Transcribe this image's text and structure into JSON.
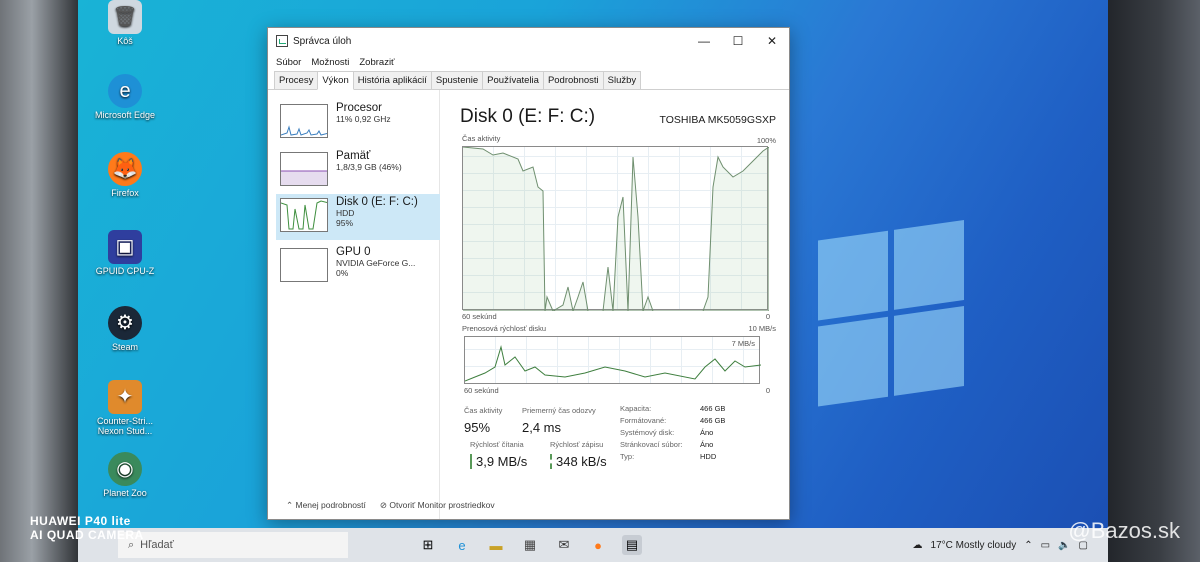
{
  "desktop": {
    "icons": [
      {
        "label": "Kôš",
        "icon": "recycle-bin-icon"
      },
      {
        "label": "Microsoft Edge",
        "icon": "edge-icon"
      },
      {
        "label": "Firefox",
        "icon": "firefox-icon"
      },
      {
        "label": "GPUID CPU-Z",
        "icon": "cpuz-icon"
      },
      {
        "label": "Steam",
        "icon": "steam-icon"
      },
      {
        "label": "Counter-Stri... Nexon Stud...",
        "icon": "counter-strike-icon"
      },
      {
        "label": "Planet Zoo",
        "icon": "planet-zoo-icon"
      }
    ]
  },
  "window": {
    "title": "Správca úloh",
    "menu": [
      "Súbor",
      "Možnosti",
      "Zobraziť"
    ],
    "tabs": [
      "Procesy",
      "Výkon",
      "História aplikácií",
      "Spustenie",
      "Používatelia",
      "Podrobnosti",
      "Služby"
    ],
    "active_tab": "Výkon",
    "resources": [
      {
        "name": "Procesor",
        "line1": "11% 0,92 GHz",
        "line2": ""
      },
      {
        "name": "Pamäť",
        "line1": "1,8/3,9 GB (46%)",
        "line2": ""
      },
      {
        "name": "Disk 0 (E: F: C:)",
        "line1": "HDD",
        "line2": "95%"
      },
      {
        "name": "GPU 0",
        "line1": "NVIDIA GeForce G...",
        "line2": "0%"
      }
    ],
    "detail": {
      "title": "Disk 0 (E: F: C:)",
      "model": "TOSHIBA MK5059GSXP",
      "graph1_label": "Čas aktivity",
      "graph1_max": "100%",
      "graph1_time": "60 sekúnd",
      "graph1_min": "0",
      "graph2_label": "Prenosová rýchlosť disku",
      "graph2_max": "10 MB/s",
      "graph2_mid": "7 MB/s",
      "graph2_time": "60 sekúnd",
      "graph2_min": "0",
      "stats": {
        "active_time_label": "Čas aktivity",
        "active_time": "95%",
        "resp_label": "Priemerný čas odozvy",
        "resp": "2,4 ms",
        "read_label": "Rýchlosť čítania",
        "read": "3,9 MB/s",
        "write_label": "Rýchlosť zápisu",
        "write": "348 kB/s"
      },
      "props": [
        {
          "k": "Kapacita:",
          "v": "466 GB"
        },
        {
          "k": "Formátované:",
          "v": "466 GB"
        },
        {
          "k": "Systémový disk:",
          "v": "Áno"
        },
        {
          "k": "Stránkovací súbor:",
          "v": "Áno"
        },
        {
          "k": "Typ:",
          "v": "HDD"
        }
      ]
    },
    "footer": {
      "less_details": "Menej podrobností",
      "open_monitor": "Otvoriť Monitor prostriedkov"
    }
  },
  "taskbar": {
    "search_placeholder": "Hľadať",
    "weather": "17°C  Mostly cloudy"
  },
  "watermark": {
    "line1": "HUAWEI P40 lite",
    "line2": "AI QUAD CAMERA",
    "site": "@Bazos.sk"
  }
}
